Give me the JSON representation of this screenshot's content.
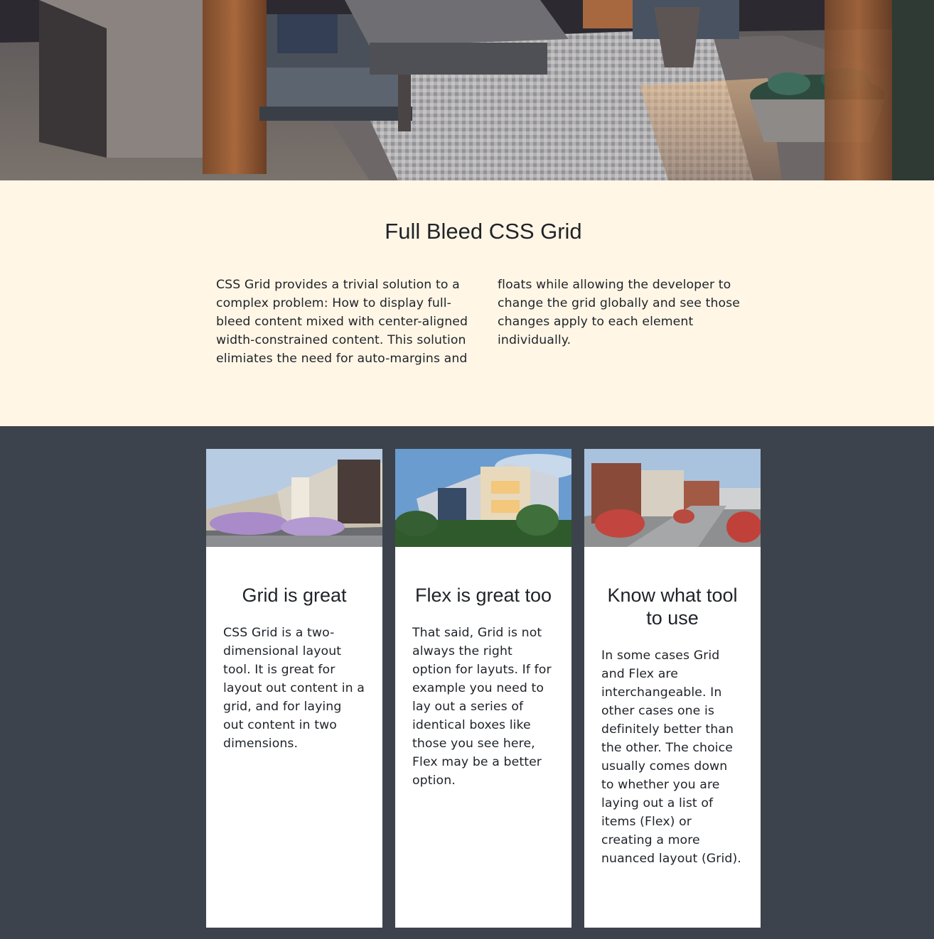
{
  "hero": {
    "image": "outdoor-lounge-photo"
  },
  "intro": {
    "title": "Full Bleed CSS Grid",
    "body": "CSS Grid provides a trivial solution to a complex problem: How to display full-bleed content mixed with center-aligned width-constrained content. This solution elimiates the need for auto-margins and floats while allowing the developer to change the grid globally and see those changes apply to each element individually."
  },
  "cards": [
    {
      "image": "townhouse-street-photo",
      "title": "Grid is great",
      "text": "CSS Grid is a two-dimensional layout tool. It is great for layout out content in a grid, and for laying out content in two dimensions."
    },
    {
      "image": "modern-apartment-photo",
      "title": "Flex is great too",
      "text": "That said, Grid is not always the right option for layuts. If for example you need to lay out a series of identical boxes like those you see here, Flex may be a better option."
    },
    {
      "image": "city-block-photo",
      "title": "Know what tool to use",
      "text": "In some cases Grid and Flex are interchangeable. In other cases one is definitely better than the other. The choice usually comes down to whether you are laying out a list of items (Flex) or creating a more nuanced layout (Grid)."
    }
  ],
  "colors": {
    "intro_background": "#fff6e6",
    "cards_background": "#3d434c",
    "card_background": "#ffffff",
    "text": "#1f2328"
  }
}
